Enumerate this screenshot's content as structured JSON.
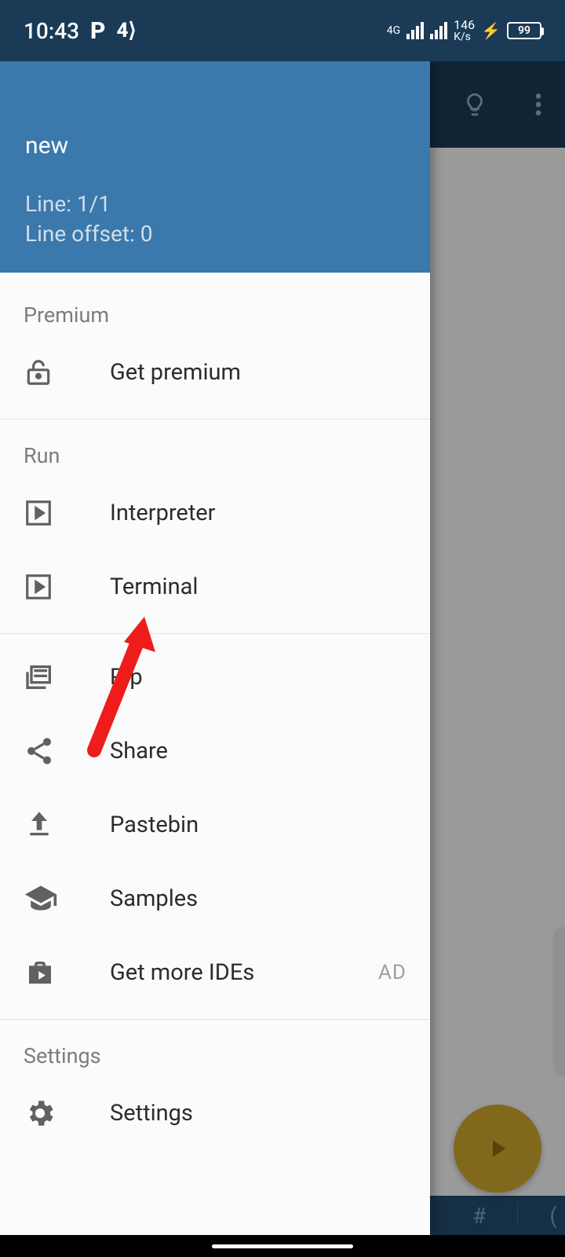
{
  "status": {
    "time": "10:43",
    "network_label": "4G",
    "speed_value": "146",
    "speed_unit": "K/s",
    "battery_pct": "99"
  },
  "drawer": {
    "title": "new",
    "line_info": "Line: 1/1",
    "offset_info": "Line offset: 0",
    "sections": {
      "premium": {
        "label": "Premium",
        "get_premium": "Get premium"
      },
      "run": {
        "label": "Run",
        "interpreter": "Interpreter",
        "terminal": "Terminal"
      },
      "tools": {
        "pip": "Pip",
        "share": "Share",
        "pastebin": "Pastebin",
        "samples": "Samples",
        "more_ides": "Get more IDEs",
        "ad_badge": "AD"
      },
      "settings": {
        "label": "Settings",
        "settings": "Settings"
      }
    }
  },
  "bottom_bar": {
    "hash": "#",
    "paren": "("
  }
}
